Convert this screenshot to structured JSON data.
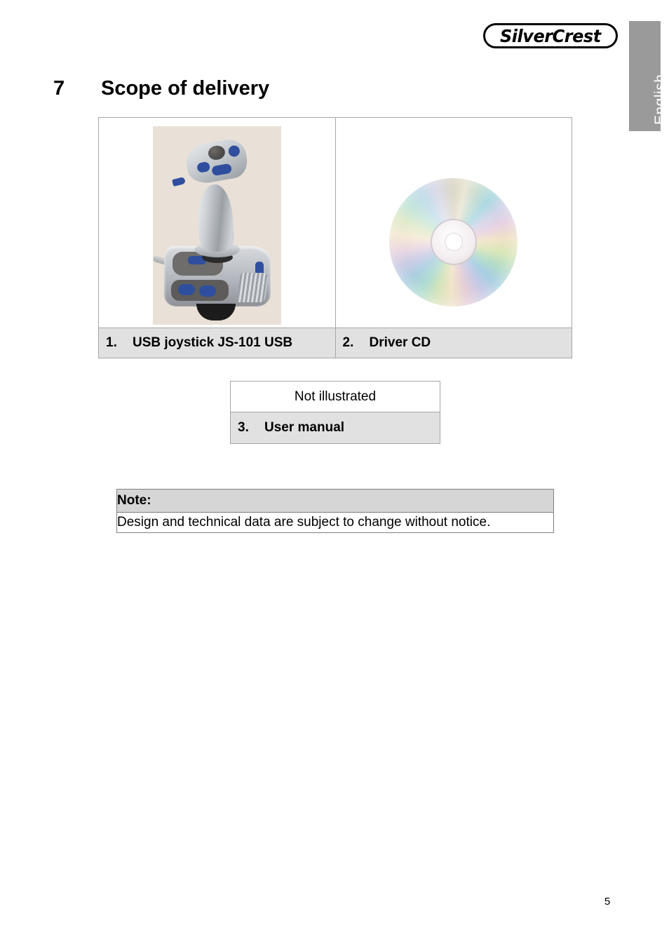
{
  "document": {
    "language_tab": "English",
    "brand": "SilverCrest",
    "page_number": "5"
  },
  "heading": {
    "number": "7",
    "title": "Scope of delivery"
  },
  "scope_table": {
    "items": [
      {
        "number": "1.",
        "label": "USB joystick JS-101 USB",
        "image": "joystick-photo"
      },
      {
        "number": "2.",
        "label": "Driver CD",
        "image": "cd-photo"
      }
    ]
  },
  "not_illustrated_table": {
    "header": "Not illustrated",
    "item": {
      "number": "3.",
      "label": "User manual"
    }
  },
  "note_box": {
    "header": "Note:",
    "body": "Design and technical data are subject to change without notice."
  },
  "colors": {
    "caption_row_bg": "#e1e1e1",
    "note_header_bg": "#d6d6d6",
    "tab_bg": "#9a9a9a",
    "border": "#a6a6a6"
  }
}
